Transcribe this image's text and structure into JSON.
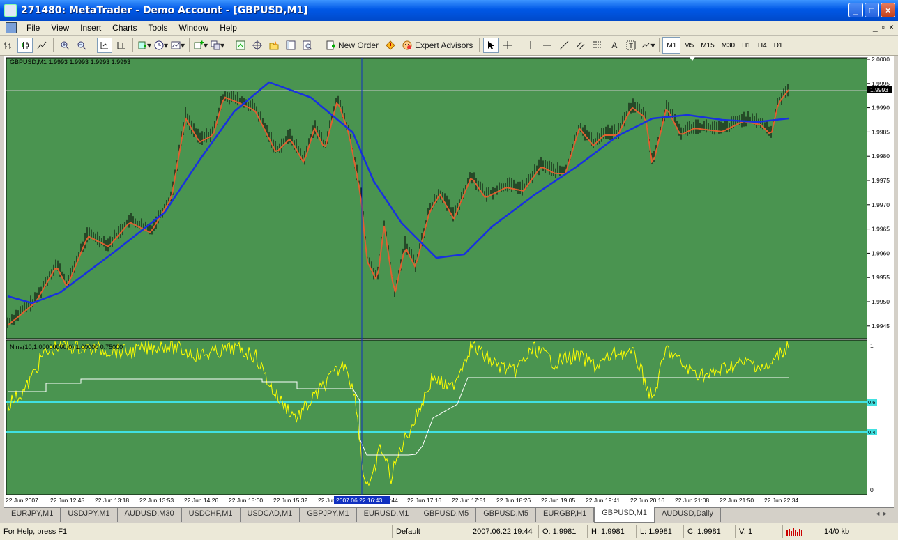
{
  "window": {
    "title": "271480: MetaTrader - Demo Account - [GBPUSD,M1]",
    "buttons": [
      "_",
      "□",
      "×"
    ]
  },
  "menu": {
    "items": [
      "File",
      "View",
      "Insert",
      "Charts",
      "Tools",
      "Window",
      "Help"
    ],
    "mdi": [
      "_",
      "▫",
      "×"
    ]
  },
  "toolbar": {
    "new_order": "New Order",
    "expert_advisors": "Expert Advisors",
    "timeframes": [
      "M1",
      "M5",
      "M15",
      "M30",
      "H1",
      "H4",
      "D1"
    ],
    "active_timeframe": "M1"
  },
  "chart": {
    "symbol_label": "GBPUSD,M1  1.9993 1.9993 1.9993 1.9993",
    "indicator_label": "Nina(10,1.00000000,0) 1.00000 0.75000",
    "current_price_label": "1.9993",
    "price_ticks": [
      "2.0000",
      "1.9995",
      "1.9990",
      "1.9985",
      "1.9980",
      "1.9975",
      "1.9970",
      "1.9965",
      "1.9960",
      "1.9955",
      "1.9950",
      "1.9945"
    ],
    "indicator_ticks": [
      "1",
      "0"
    ],
    "level_labels": [
      "0.6",
      "0.4"
    ],
    "time_labels": [
      "22 Jun 2007",
      "22 Jun 12:45",
      "22 Jun 13:18",
      "22 Jun 13:53",
      "22 Jun 14:26",
      "22 Jun 15:00",
      "22 Jun 15:32",
      "22 Jun",
      ":44",
      "22 Jun 17:16",
      "22 Jun 17:51",
      "22 Jun 18:26",
      "22 Jun 19:05",
      "22 Jun 19:41",
      "22 Jun 20:16",
      "22 Jun 21:08",
      "22 Jun 21:50",
      "22 Jun 22:34"
    ],
    "crosshair_time": "2007.06.22 16:43",
    "colors": {
      "background": "#4a9450",
      "candles": "#000000",
      "ma_fast": "#e06030",
      "ma_slow": "#1830e0",
      "indicator": "#ffff00",
      "indicator_signal": "#ffffff",
      "levels": "#40e0e0",
      "crosshair": "#1030c0"
    }
  },
  "chart_tabs": [
    "EURJPY,M1",
    "USDJPY,M1",
    "AUDUSD,M30",
    "USDCHF,M1",
    "USDCAD,M1",
    "GBPJPY,M1",
    "EURUSD,M1",
    "GBPUSD,M5",
    "GBPUSD,M5",
    "EURGBP,H1",
    "GBPUSD,M1",
    "AUDUSD,Daily"
  ],
  "active_tab": "GBPUSD,M1",
  "status": {
    "help": "For Help, press F1",
    "profile": "Default",
    "datetime": "2007.06.22 19:44",
    "open": "O: 1.9981",
    "high": "H: 1.9981",
    "low": "L: 1.9981",
    "close": "C: 1.9981",
    "volume": "V: 1",
    "traffic": "14/0 kb"
  }
}
